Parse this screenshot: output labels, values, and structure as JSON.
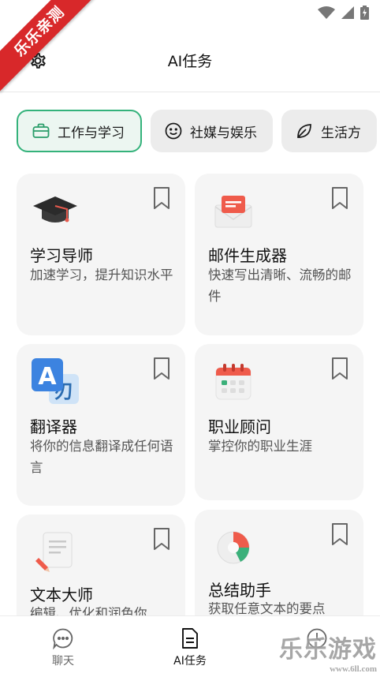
{
  "ribbon_text": "乐乐亲测",
  "header": {
    "title": "AI任务"
  },
  "tabs": [
    {
      "label": "工作与学习",
      "icon": "briefcase-icon",
      "active": true
    },
    {
      "label": "社媒与娱乐",
      "icon": "smiley-icon",
      "active": false
    },
    {
      "label": "生活方",
      "icon": "leaf-icon",
      "active": false
    }
  ],
  "cards": [
    {
      "title": "学习导师",
      "desc": "加速学习，提升知识水平",
      "icon": "graduation-cap-icon"
    },
    {
      "title": "邮件生成器",
      "desc": "快速写出清晰、流畅的邮件",
      "icon": "mail-icon"
    },
    {
      "title": "翻译器",
      "desc": "将你的信息翻译成任何语言",
      "icon": "translate-icon"
    },
    {
      "title": "职业顾问",
      "desc": "掌控你的职业生涯",
      "icon": "calendar-icon"
    },
    {
      "title": "文本大师",
      "desc": "编辑、优化和润色你",
      "icon": "document-pen-icon"
    },
    {
      "title": "总结助手",
      "desc": "获取任意文本的要点",
      "icon": "pie-chart-icon"
    }
  ],
  "bottom_nav": [
    {
      "label": "聊天",
      "icon": "chat-icon",
      "active": false
    },
    {
      "label": "AI任务",
      "icon": "task-doc-icon",
      "active": true
    },
    {
      "label": "",
      "icon": "clock-icon",
      "active": false
    }
  ],
  "watermark": {
    "text": "乐乐游戏",
    "sub": "www.6ll.com"
  },
  "colors": {
    "accent": "#34b27b",
    "ribbon": "#d8282a"
  }
}
